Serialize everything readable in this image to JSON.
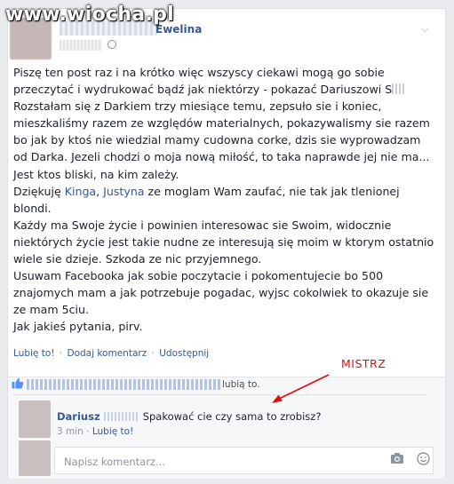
{
  "watermark": "www.wiocha.pl",
  "post": {
    "author_visible": "Ewelina",
    "menu_icon": "chevron-down-icon",
    "lines": [
      "Piszę ten post raz i na krótko więc wszyscy ciekawi mogą go sobie",
      "przeczytać i wydrukować bądź jak niektórzy - pokazać Dariuszowi S",
      "Rozstałam się z Darkiem trzy miesiące temu, zepsuło sie i koniec,",
      "mieszkaliśmy razem ze względów materialnych, pokazywalismy sie razem",
      "bo jak by ktoś nie wiedzial mamy cudowna corke, dzis sie wyprowadzam",
      "od Darka. Jezeli chodzi o moja nową miłość, to taka naprawde jej nie ma...",
      "Jest ktos bliski, na kim zależy."
    ],
    "thanks": {
      "prefix": "Dziękuję ",
      "tag1": "Kinga",
      "comma": ", ",
      "tag2": "Justyna",
      "suffix": " ze moglam Wam zaufać, nie tak jak tlenionej"
    },
    "lines2": [
      "blondi.",
      "Każdy ma Swoje życie i powinien interesowac sie Swoim, widocznie",
      "niektórych życie jest takie nudne ze interesują się moim w ktorym ostatnio",
      "wiele sie dzieje. Szkoda ze nic przyjemnego.",
      "Usuwam Facebooka jak sobie poczytacie i pokomentujecie bo 500",
      "znajomych mam a jak potrzebuje pogadac, wyjsc cokolwiek to okazuje sie",
      "ze mam 5ciu.",
      "Jak jakieś pytania, pirv."
    ]
  },
  "actions": {
    "like": "Lubię to!",
    "comment": "Dodaj komentarz",
    "share": "Udostępnij",
    "separator": "·"
  },
  "likes": {
    "suffix": "lubią to.",
    "icon": "thumbs-up-icon"
  },
  "comment": {
    "author": "Dariusz",
    "text": "Spakować cie czy sama to zrobisz?",
    "time": "3 min",
    "separator": "·",
    "like": "Lubię to!"
  },
  "composer": {
    "placeholder": "Napisz komentarz...",
    "camera_icon": "camera-icon",
    "emoji_icon": "smiley-icon"
  },
  "annotation": {
    "label": "MISTRZ",
    "color": "#dd1111"
  }
}
